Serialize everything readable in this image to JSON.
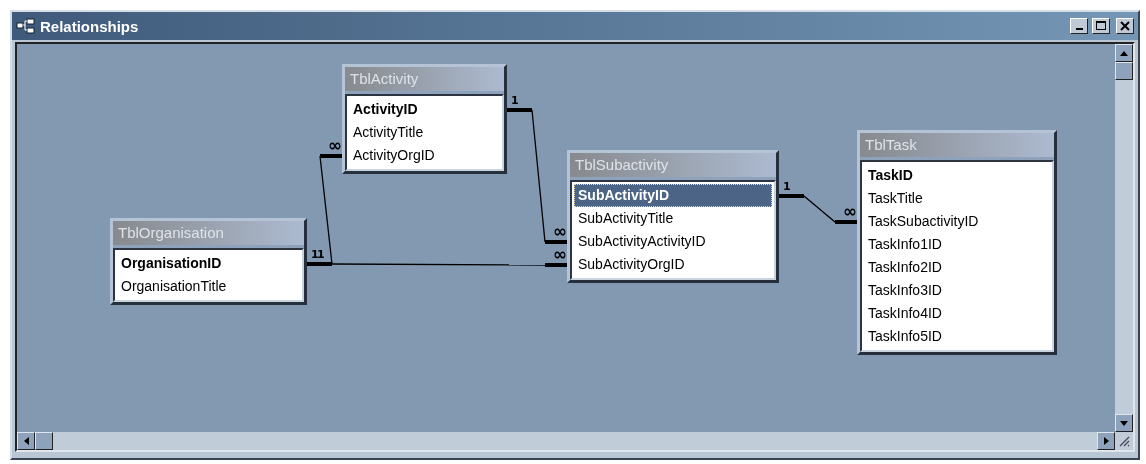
{
  "window": {
    "title": "Relationships"
  },
  "tables": [
    {
      "name": "TblActivity",
      "fields": [
        {
          "name": "ActivityID",
          "primary_key": true,
          "selected": false
        },
        {
          "name": "ActivityTitle",
          "primary_key": false,
          "selected": false
        },
        {
          "name": "ActivityOrgID",
          "primary_key": false,
          "selected": false
        }
      ]
    },
    {
      "name": "TblOrganisation",
      "fields": [
        {
          "name": "OrganisationID",
          "primary_key": true,
          "selected": false
        },
        {
          "name": "OrganisationTitle",
          "primary_key": false,
          "selected": false
        }
      ]
    },
    {
      "name": "TblSubactivity",
      "fields": [
        {
          "name": "SubActivityID",
          "primary_key": true,
          "selected": true
        },
        {
          "name": "SubActivityTitle",
          "primary_key": false,
          "selected": false
        },
        {
          "name": "SubActivityActivityID",
          "primary_key": false,
          "selected": false
        },
        {
          "name": "SubActivityOrgID",
          "primary_key": false,
          "selected": false
        }
      ]
    },
    {
      "name": "TblTask",
      "fields": [
        {
          "name": "TaskID",
          "primary_key": true,
          "selected": false
        },
        {
          "name": "TaskTitle",
          "primary_key": false,
          "selected": false
        },
        {
          "name": "TaskSubactivityID",
          "primary_key": false,
          "selected": false
        },
        {
          "name": "TaskInfo1ID",
          "primary_key": false,
          "selected": false
        },
        {
          "name": "TaskInfo2ID",
          "primary_key": false,
          "selected": false
        },
        {
          "name": "TaskInfo3ID",
          "primary_key": false,
          "selected": false
        },
        {
          "name": "TaskInfo4ID",
          "primary_key": false,
          "selected": false
        },
        {
          "name": "TaskInfo5ID",
          "primary_key": false,
          "selected": false
        }
      ]
    }
  ],
  "relationships": [
    {
      "from_label": "1",
      "to_label": "∞"
    },
    {
      "from_label": "1",
      "to_label": "∞"
    },
    {
      "from_label": "1",
      "to_label": "∞"
    },
    {
      "from_label": "1",
      "to_label": "∞"
    }
  ]
}
